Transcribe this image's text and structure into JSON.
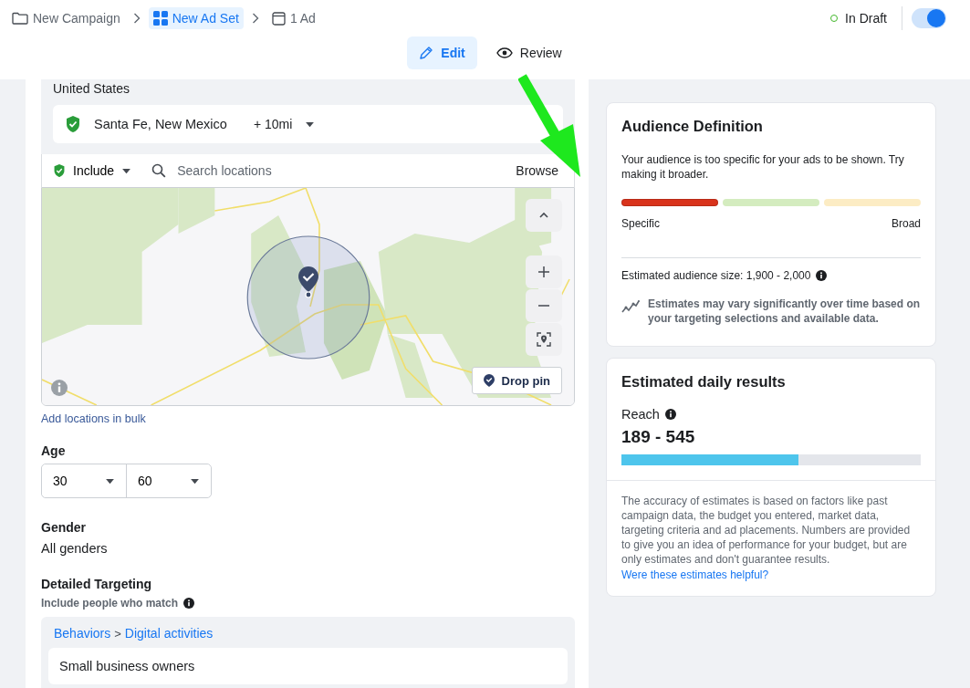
{
  "breadcrumbs": [
    {
      "label": "New Campaign",
      "kind": "campaign",
      "selected": false
    },
    {
      "label": "New Ad Set",
      "kind": "adset",
      "selected": true
    },
    {
      "label": "1 Ad",
      "kind": "ad",
      "selected": false
    }
  ],
  "status": {
    "label": "In Draft",
    "on": true
  },
  "tabs": [
    {
      "label": "Edit",
      "kind": "edit",
      "selected": true
    },
    {
      "label": "Review",
      "kind": "review",
      "selected": false
    }
  ],
  "locations": {
    "country": "United States",
    "items": [
      {
        "name": "Santa Fe, New Mexico",
        "radius": "+ 10mi"
      }
    ],
    "filter": "Include",
    "search": {
      "placeholder": "Search locations"
    },
    "browse": "Browse",
    "drop_pin": "Drop pin",
    "bulk_link": "Add locations in bulk"
  },
  "age": {
    "label": "Age",
    "min": "30",
    "max": "60"
  },
  "gender": {
    "label": "Gender",
    "value": "All genders"
  },
  "detailed_targeting": {
    "label": "Detailed Targeting",
    "hint": "Include people who match",
    "groups": [
      {
        "path": [
          "Behaviors",
          "Digital activities"
        ],
        "separator": ">",
        "items": [
          "Small business owners"
        ]
      }
    ]
  },
  "audience": {
    "title": "Audience Definition",
    "message": "Your audience is too specific for your ads to be shown. Try making it broader.",
    "segments": [
      {
        "color": "#d9331c",
        "selected": true
      },
      {
        "color": "#d4ecbf",
        "selected": false
      },
      {
        "color": "#fcecc4",
        "selected": false
      }
    ],
    "low_label": "Specific",
    "high_label": "Broad",
    "size": "Estimated audience size: 1,900 - 2,000",
    "note": "Estimates may vary significantly over time based on your targeting selections and available data."
  },
  "daily_results": {
    "title": "Estimated daily results",
    "metric": "Reach",
    "range": "189 - 545",
    "level": 0.59,
    "disclaimer": "The accuracy of estimates is based on factors like past campaign data, the budget you entered, market data, targeting criteria and ad placements. Numbers are provided to give you an idea of performance for your budget, but are only estimates and don't guarantee results.",
    "feedback_link": "Were these estimates helpful?"
  }
}
